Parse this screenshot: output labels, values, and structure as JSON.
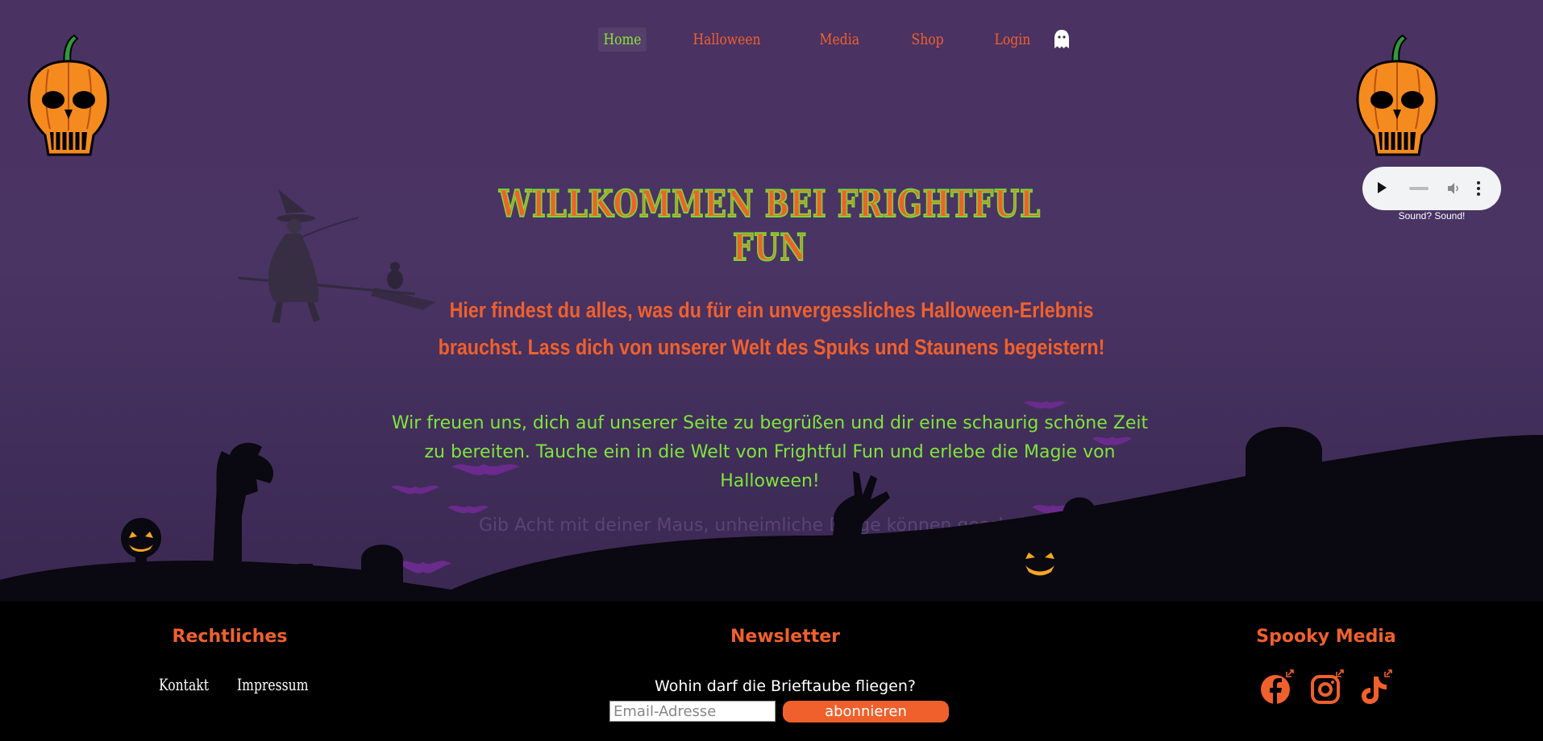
{
  "nav": {
    "items": [
      {
        "label": "Home",
        "active": true
      },
      {
        "label": "Halloween",
        "active": false
      },
      {
        "label": "Media",
        "active": false
      },
      {
        "label": "Shop",
        "active": false
      },
      {
        "label": "Login",
        "active": false
      }
    ],
    "login_icon": "ghost-icon"
  },
  "audio": {
    "caption": "Sound? Sound!",
    "controls": [
      "play-icon",
      "volume-icon",
      "more-options-icon"
    ]
  },
  "hero": {
    "headline": "Willkommen bei Frightful Fun",
    "intro": "Hier findest du alles, was du für ein unvergessliches Halloween-Erlebnis brauchst. Lass dich von unserer Welt des Spuks und Staunens begeistern!",
    "welcome": "Wir freuen uns, dich auf unserer Seite zu begrüßen und dir eine schaurig schöne Zeit zu bereiten. Tauche ein in die Welt von Frightful Fun und erlebe die Magie von Halloween!",
    "warning": "Gib Acht mit deiner Maus, unheimliche Dinge können geschehen!"
  },
  "footer": {
    "legal": {
      "title": "Rechtliches",
      "links": [
        "Kontakt",
        "Impressum"
      ]
    },
    "newsletter": {
      "title": "Newsletter",
      "question": "Wohin darf die Brieftaube fliegen?",
      "email_placeholder": "Email-Adresse",
      "button": "abonnieren"
    },
    "media": {
      "title": "Spooky Media",
      "icons": [
        "facebook-icon",
        "instagram-icon",
        "tiktok-icon"
      ]
    }
  },
  "colors": {
    "accent": "#f0602c",
    "green": "#7ee63a",
    "background": "#4a3262",
    "footer": "#000000"
  }
}
